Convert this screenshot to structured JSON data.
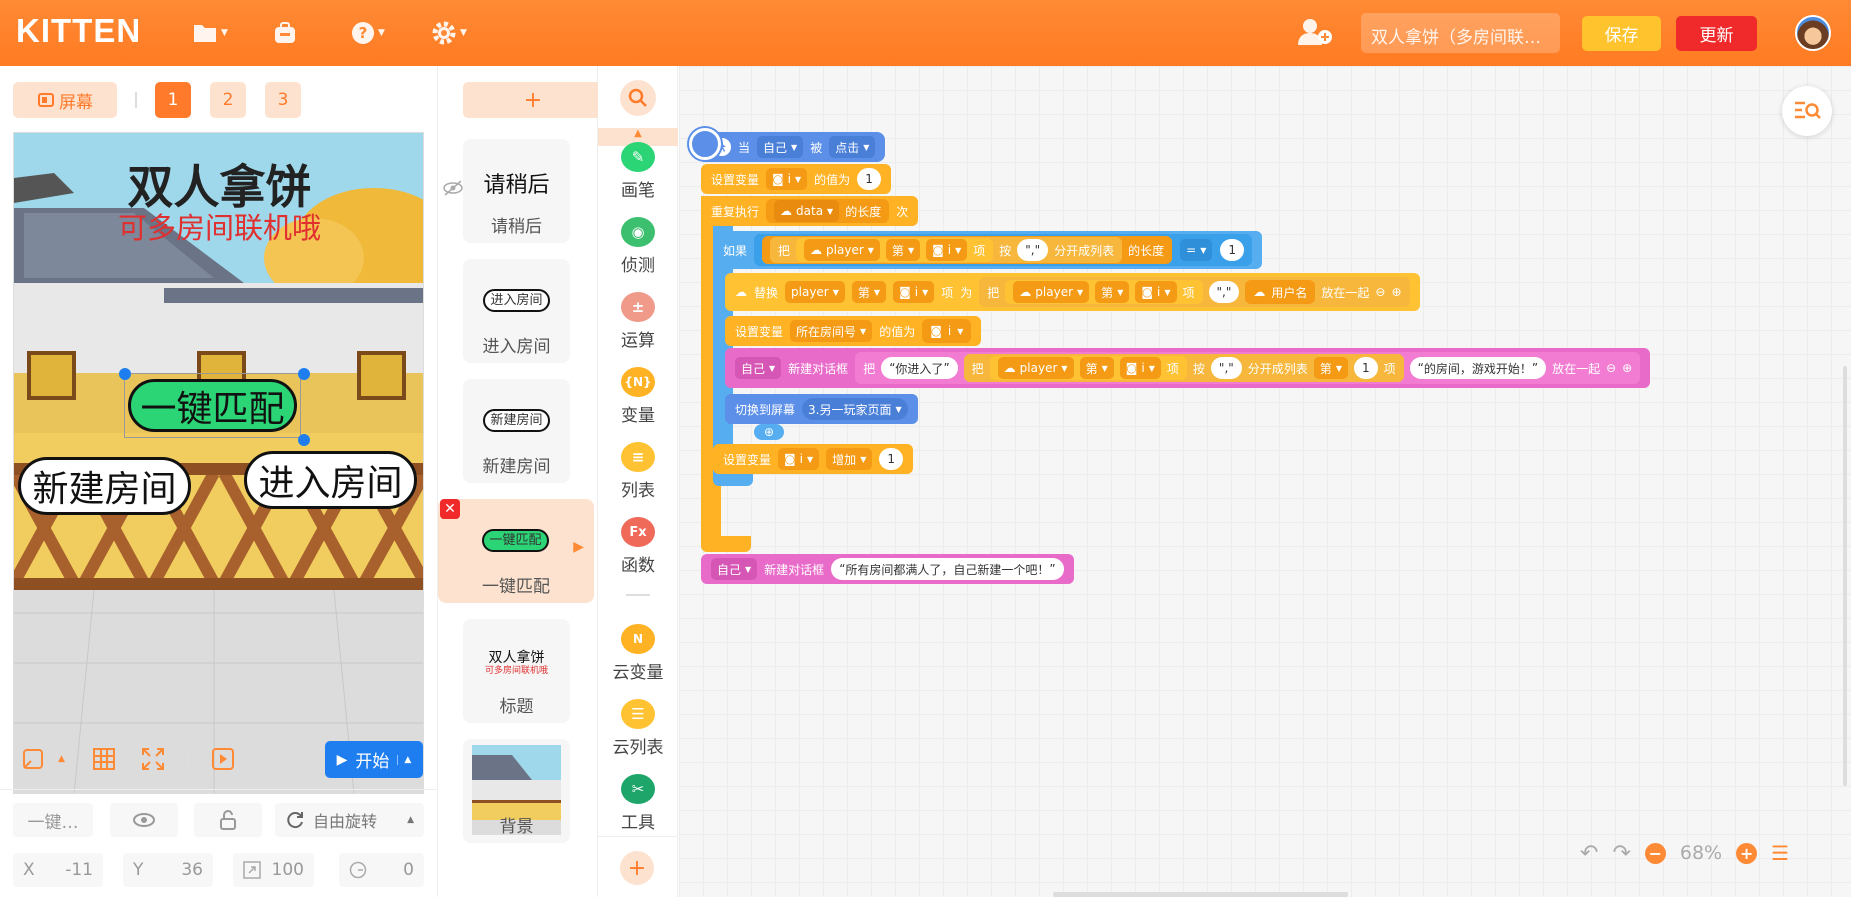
{
  "app": {
    "logo": "KITTEN",
    "project_name": "双人拿饼（多房间联…",
    "save": "保存",
    "update": "更新"
  },
  "colors": {
    "brand": "#ff7b22",
    "events": "#5b8fe8",
    "control": "#ffb224",
    "variables": "#ff8c1a",
    "lists": "#f6b73c",
    "cloud": "#e96bc9",
    "accent_blue": "#1e7ef0"
  },
  "stage": {
    "screen_btn": "屏幕",
    "pages": [
      "1",
      "2",
      "3"
    ],
    "title": "双人拿饼",
    "subtitle": "可多房间联机哦",
    "btn_match": "一键匹配",
    "btn_new": "新建房间",
    "btn_enter": "进入房间",
    "start": "开始"
  },
  "props": {
    "name": "一键…",
    "rotation": "自由旋转",
    "x_label": "X",
    "x": "-11",
    "y_label": "Y",
    "y": "36",
    "size": "100",
    "dir": "0"
  },
  "sprites": {
    "add": "+",
    "items": [
      {
        "label": "请稍后",
        "thumb": "请稍后"
      },
      {
        "label": "进入房间",
        "thumb": "进入房间"
      },
      {
        "label": "新建房间",
        "thumb": "新建房间"
      },
      {
        "label": "一键匹配",
        "thumb": "一键匹配"
      },
      {
        "label": "标题",
        "thumb": "双人拿饼",
        "thumb2": "可多房间联机哦"
      },
      {
        "label": "背景"
      }
    ]
  },
  "categories": [
    {
      "label": "画笔",
      "icon": "pen-icon"
    },
    {
      "label": "侦测",
      "icon": "sensor-icon"
    },
    {
      "label": "运算",
      "icon": "operator-icon"
    },
    {
      "label": "变量",
      "icon": "{N}"
    },
    {
      "label": "列表",
      "icon": "list-icon"
    },
    {
      "label": "函数",
      "icon": "Fx"
    },
    {
      "label": "云变量",
      "icon": "N"
    },
    {
      "label": "云列表",
      "icon": "cloud-list-icon"
    },
    {
      "label": "工具",
      "icon": "tools-icon"
    }
  ],
  "blocks": {
    "when": "当",
    "self": "自己",
    "by": "被",
    "clicked": "点击",
    "set_var": "设置变量",
    "var_i": "i",
    "value_is": "的值为",
    "one": "1",
    "repeat": "重复执行",
    "data": "data",
    "length_of": "的长度",
    "times": "次",
    "if": "如果",
    "take": "把",
    "player": "player",
    "nth": "第",
    "item": "项",
    "by_sep": "按",
    "comma": "\",\"",
    "split": "分开成列表",
    "eq": "=",
    "replace": "替换",
    "as": "为",
    "username": "用户名",
    "join": "放在一起",
    "room_var": "所在房间号",
    "new_dialog": "新建对话框",
    "you_entered": "你进入了",
    "room_start": "的房间，游戏开始！",
    "switch_screen": "切换到屏幕",
    "screen_target": "3.另一玩家页面",
    "inc": "增加",
    "all_full": "所有房间都满人了，自己新建一个吧！"
  },
  "zoom": {
    "level": "68%"
  }
}
